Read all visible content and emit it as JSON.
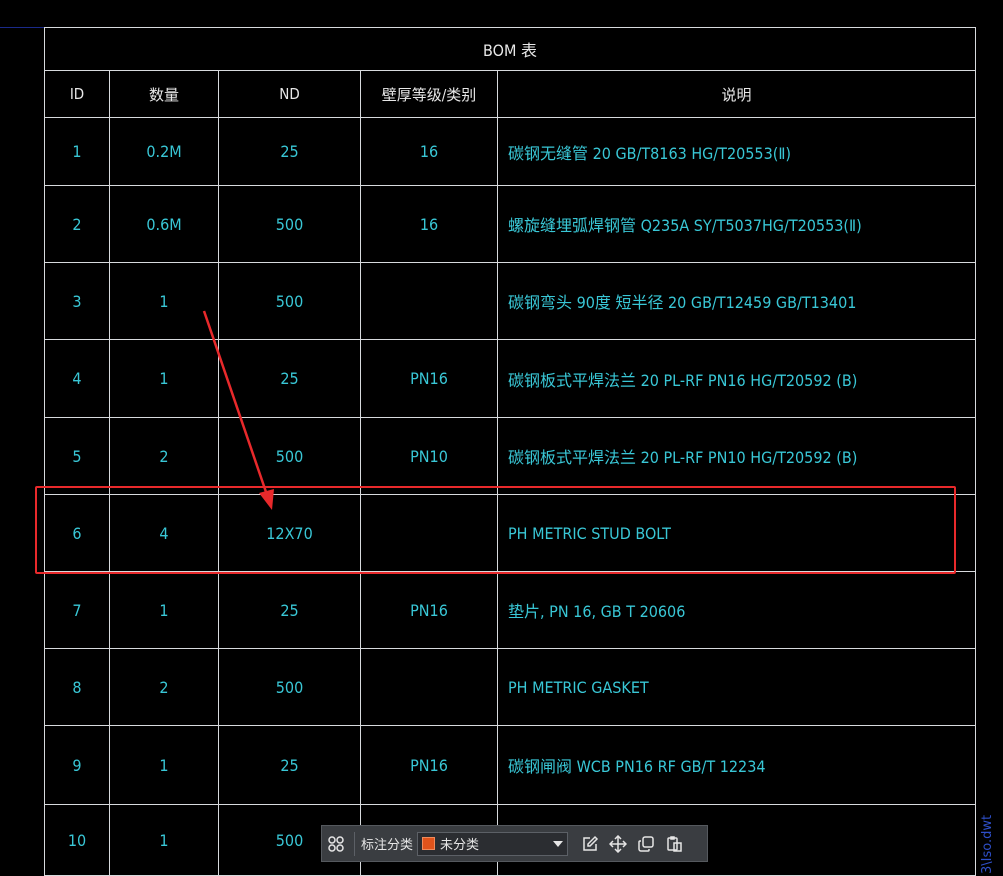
{
  "table": {
    "title": "BOM 表",
    "headers": [
      "ID",
      "数量",
      "ND",
      "壁厚等级/类别",
      "说明"
    ],
    "rows": [
      {
        "id": "1",
        "qty": "0.2M",
        "nd": "25",
        "grade": "16",
        "desc": "碳钢无缝管  20  GB/T8163  HG/T20553(Ⅱ)"
      },
      {
        "id": "2",
        "qty": "0.6M",
        "nd": "500",
        "grade": "16",
        "desc": "螺旋缝埋弧焊钢管  Q235A  SY/T5037HG/T20553(Ⅱ)"
      },
      {
        "id": "3",
        "qty": "1",
        "nd": "500",
        "grade": "",
        "desc": "碳钢弯头 90度 短半径 20  GB/T12459  GB/T13401"
      },
      {
        "id": "4",
        "qty": "1",
        "nd": "25",
        "grade": "PN16",
        "desc": "碳钢板式平焊法兰 20  PL-RF  PN16  HG/T20592 (B)"
      },
      {
        "id": "5",
        "qty": "2",
        "nd": "500",
        "grade": "PN10",
        "desc": "碳钢板式平焊法兰 20  PL-RF  PN10  HG/T20592 (B)"
      },
      {
        "id": "6",
        "qty": "4",
        "nd": "12X70",
        "grade": "",
        "desc": "PH METRIC STUD BOLT"
      },
      {
        "id": "7",
        "qty": "1",
        "nd": "25",
        "grade": "PN16",
        "desc": "垫片, PN 16, GB T 20606"
      },
      {
        "id": "8",
        "qty": "2",
        "nd": "500",
        "grade": "",
        "desc": "PH METRIC GASKET"
      },
      {
        "id": "9",
        "qty": "1",
        "nd": "25",
        "grade": "PN16",
        "desc": "碳钢闸阀 WCB PN16  RF GB/T 12234"
      },
      {
        "id": "10",
        "qty": "1",
        "nd": "500",
        "grade": "",
        "desc": ""
      }
    ]
  },
  "toolbar": {
    "category_label": "标注分类",
    "category_value": "未分类",
    "category_color": "#e0531b"
  },
  "file_path": "3\\Iso.dwt",
  "annotation": {
    "highlight_color": "#e8292b"
  }
}
